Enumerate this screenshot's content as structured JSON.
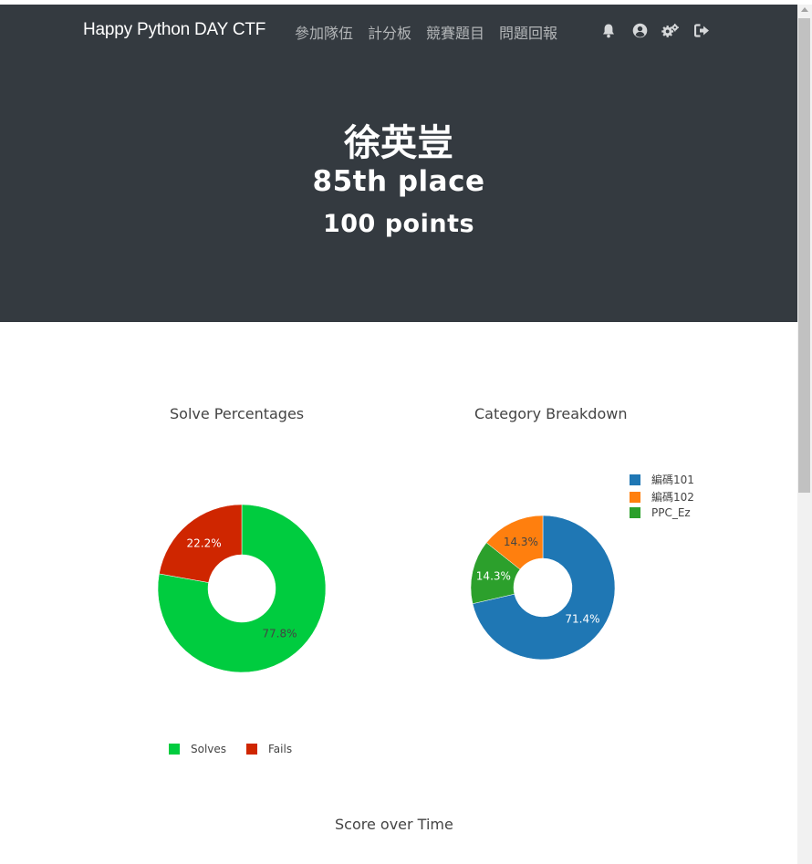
{
  "navbar": {
    "brand": "Happy Python DAY CTF",
    "links": [
      "參加隊伍",
      "計分板",
      "競賽題目",
      "問題回報"
    ],
    "icons": [
      "bell-icon",
      "user-circle-icon",
      "cogs-icon",
      "sign-out-icon"
    ]
  },
  "team": {
    "name": "徐英豈",
    "place": "85th place",
    "points": "100 points"
  },
  "colors": {
    "navbar": "#343a40",
    "solves": "#00cc3f",
    "fails": "#cf2600",
    "cat1": "#1f77b4",
    "cat2": "#ff7f0e",
    "cat3": "#2ca02c"
  },
  "charts": {
    "solve_title": "Solve Percentages",
    "category_title": "Category Breakdown",
    "score_title": "Score over Time"
  },
  "chart_data": [
    {
      "type": "pie",
      "title": "Solve Percentages",
      "hole": true,
      "labels": [
        "Solves",
        "Fails"
      ],
      "values": [
        77.8,
        22.2
      ],
      "display_labels": [
        "77.8%",
        "22.2%"
      ],
      "colors": [
        "#00cc3f",
        "#cf2600"
      ],
      "legend": "bottom"
    },
    {
      "type": "pie",
      "title": "Category Breakdown",
      "hole": true,
      "labels": [
        "編碼101",
        "編碼102",
        "PPC_Ez"
      ],
      "values": [
        71.4,
        14.3,
        14.3
      ],
      "display_labels": [
        "71.4%",
        "14.3%",
        "14.3%"
      ],
      "colors": [
        "#1f77b4",
        "#ff7f0e",
        "#2ca02c"
      ],
      "legend": "top-right"
    }
  ]
}
